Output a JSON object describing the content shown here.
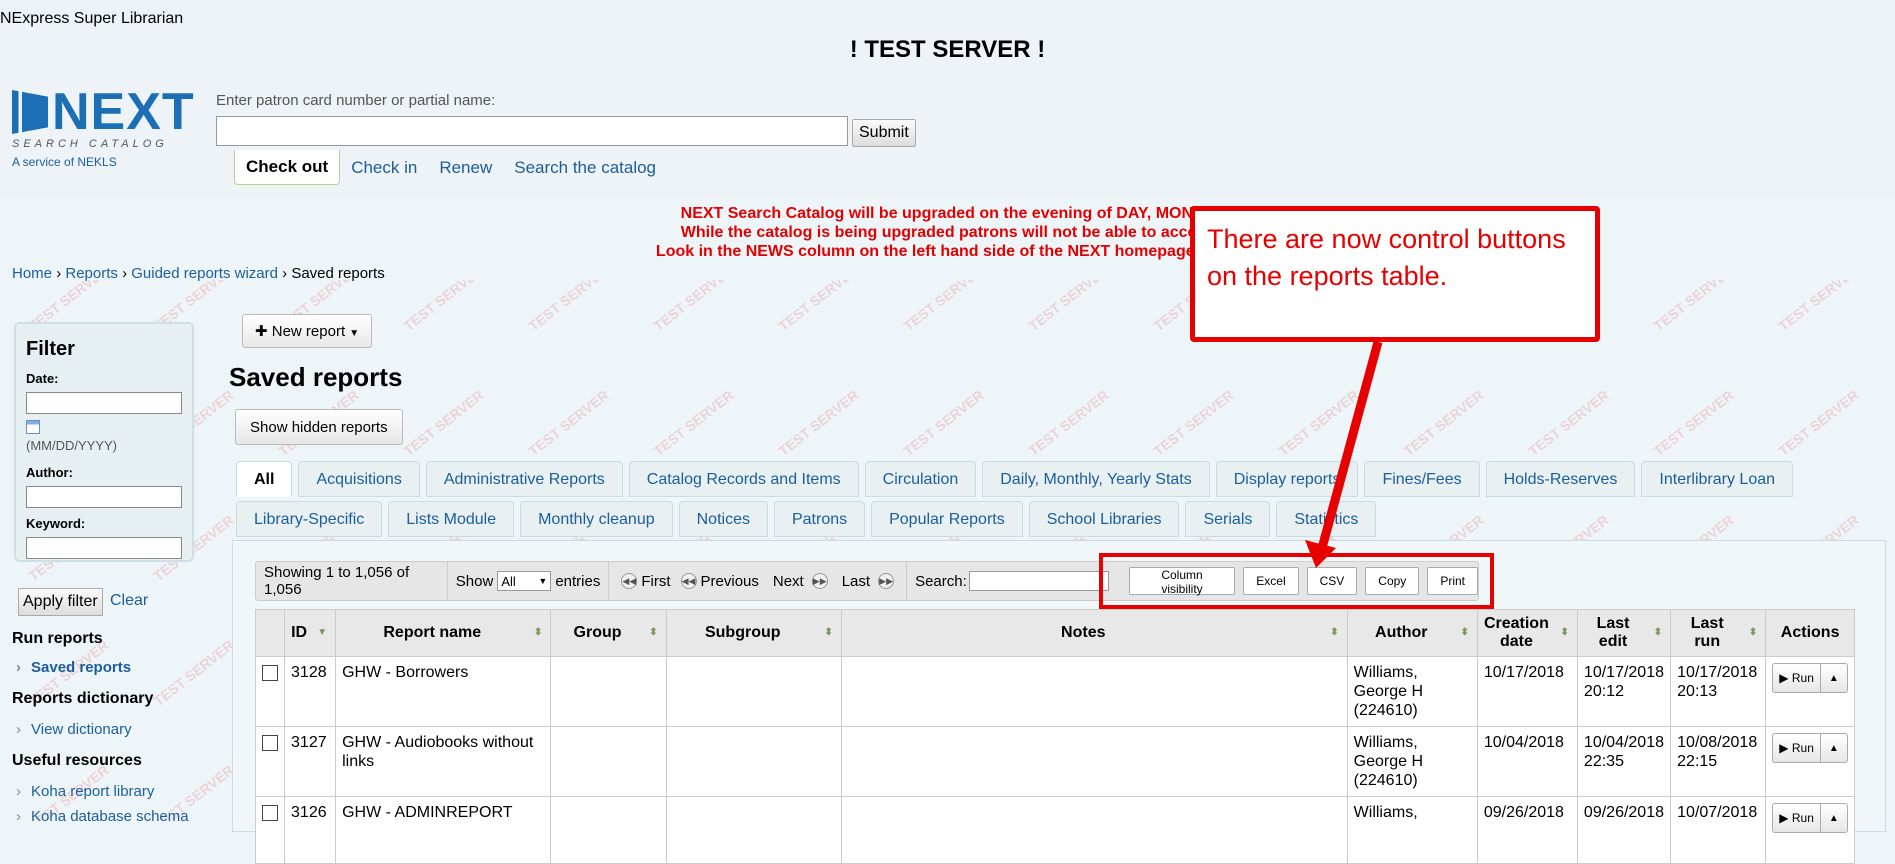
{
  "header": {
    "user_name": "NExpress Super Librarian",
    "test_banner": "! TEST SERVER !",
    "logo_text": "NEXT",
    "logo_sub": "SEARCH CATALOG",
    "service_text": "A service of NEKLS",
    "patron_label": "Enter patron card number or partial name:",
    "patron_value": "",
    "submit_label": "Submit",
    "circ_tabs": [
      "Check out",
      "Check in",
      "Renew",
      "Search the catalog"
    ]
  },
  "upgrade_banner": {
    "line1": "NEXT Search Catalog will be upgraded on the evening of DAY, MONTH",
    "line2": "While the catalog is being upgraded patrons will not be able to access",
    "line3": "Look in the NEWS column on the left hand side of the NEXT homepage for m"
  },
  "breadcrumb": {
    "home": "Home",
    "sep": "›",
    "reports": "Reports",
    "wizard": "Guided reports wizard",
    "current": "Saved reports"
  },
  "watermark_text": "TEST SERVER",
  "sidebar": {
    "filter_title": "Filter",
    "date_label": "Date:",
    "date_hint": "(MM/DD/YYYY)",
    "author_label": "Author:",
    "keyword_label": "Keyword:",
    "apply_label": "Apply filter",
    "clear_label": "Clear",
    "run_reports_head": "Run reports",
    "saved_reports": "Saved reports",
    "dictionary_head": "Reports dictionary",
    "view_dictionary": "View dictionary",
    "resources_head": "Useful resources",
    "koha_library": "Koha report library",
    "koha_schema": "Koha database schema"
  },
  "main": {
    "new_report_label": "New report",
    "page_title": "Saved reports",
    "show_hidden_label": "Show hidden reports",
    "tabs_row1": [
      "All",
      "Acquisitions",
      "Administrative Reports",
      "Catalog Records and Items",
      "Circulation",
      "Daily, Monthly, Yearly Stats",
      "Display reports",
      "Fines/Fees",
      "Holds-Reserves",
      "Interlibrary Loan"
    ],
    "tabs_row2": [
      "Library-Specific",
      "Lists Module",
      "Monthly cleanup",
      "Notices",
      "Patrons",
      "Popular Reports",
      "School Libraries",
      "Serials",
      "Statistics"
    ]
  },
  "toolbar": {
    "showing": "Showing 1 to 1,056 of 1,056",
    "show_label": "Show",
    "show_value": "All",
    "entries_label": "entries",
    "first": "First",
    "previous": "Previous",
    "next": "Next",
    "last": "Last",
    "search_label": "Search:",
    "buttons": [
      "Column visibility",
      "Excel",
      "CSV",
      "Copy",
      "Print"
    ]
  },
  "table": {
    "headers": [
      "ID",
      "Report name",
      "Group",
      "Subgroup",
      "Notes",
      "Author",
      "Creation date",
      "Last edit",
      "Last run",
      "Actions"
    ],
    "rows": [
      {
        "id": "3128",
        "name": "GHW - Borrowers",
        "group": "",
        "subgroup": "",
        "notes": "",
        "author": "Williams, George H (224610)",
        "created": "10/17/2018",
        "edited": "10/17/2018 20:12",
        "run": "10/17/2018 20:13"
      },
      {
        "id": "3127",
        "name": "GHW - Audiobooks without links",
        "group": "",
        "subgroup": "",
        "notes": "",
        "author": "Williams, George H (224610)",
        "created": "10/04/2018",
        "edited": "10/04/2018 22:35",
        "run": "10/08/2018 22:15"
      },
      {
        "id": "3126",
        "name": "GHW - ADMINREPORT",
        "group": "",
        "subgroup": "",
        "notes": "",
        "author": "Williams,",
        "created": "09/26/2018",
        "edited": "09/26/2018",
        "run": "10/07/2018"
      }
    ],
    "run_label": "Run"
  },
  "callout": {
    "text": "There are now control buttons on the reports table."
  },
  "colors": {
    "accent": "#e60000",
    "link": "#1b5e9b",
    "brand": "#1c6fb4"
  }
}
